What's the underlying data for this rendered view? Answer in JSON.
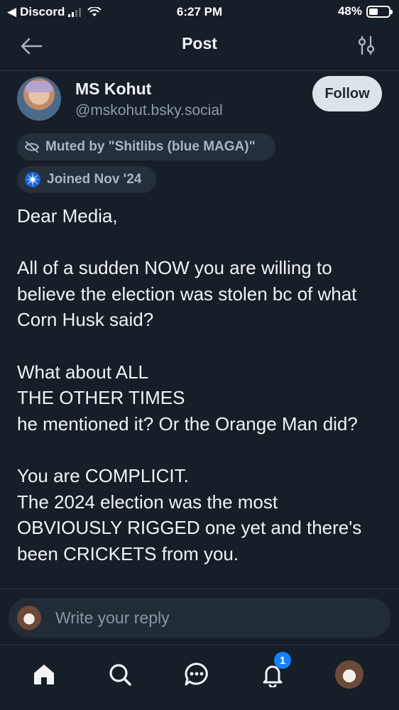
{
  "status_bar": {
    "back_app": "Discord",
    "time": "6:27 PM",
    "battery": "48%",
    "battery_level": 0.48
  },
  "header": {
    "title": "Post"
  },
  "author": {
    "name": "MS Kohut",
    "handle": "@mskohut.bsky.social",
    "follow_label": "Follow"
  },
  "badges": {
    "muted": "Muted by \"Shitlibs (blue MAGA)\"",
    "joined": "Joined Nov '24"
  },
  "post": {
    "text": "Dear Media,\n\nAll of a sudden NOW you are willing to believe the election was stolen bc of what Corn Husk said?\n\nWhat about ALL\nTHE OTHER TIMES\nhe mentioned it? Or the Orange Man did?\n\nYou are COMPLICIT.\nThe 2024 election was the most OBVIOUSLY RIGGED one yet and there's been CRICKETS from you."
  },
  "composer": {
    "placeholder": "Write your reply"
  },
  "tabbar": {
    "notification_count": "1"
  },
  "icons": [
    "back-arrow-icon",
    "filter-icon",
    "muted-eye-icon",
    "starburst-icon",
    "home-icon",
    "search-icon",
    "chat-icon",
    "bell-icon"
  ],
  "colors": {
    "background": "#161e27",
    "accent": "#1083fe",
    "muted_text": "#8e9bab",
    "follow_button": "#dce3ea"
  }
}
